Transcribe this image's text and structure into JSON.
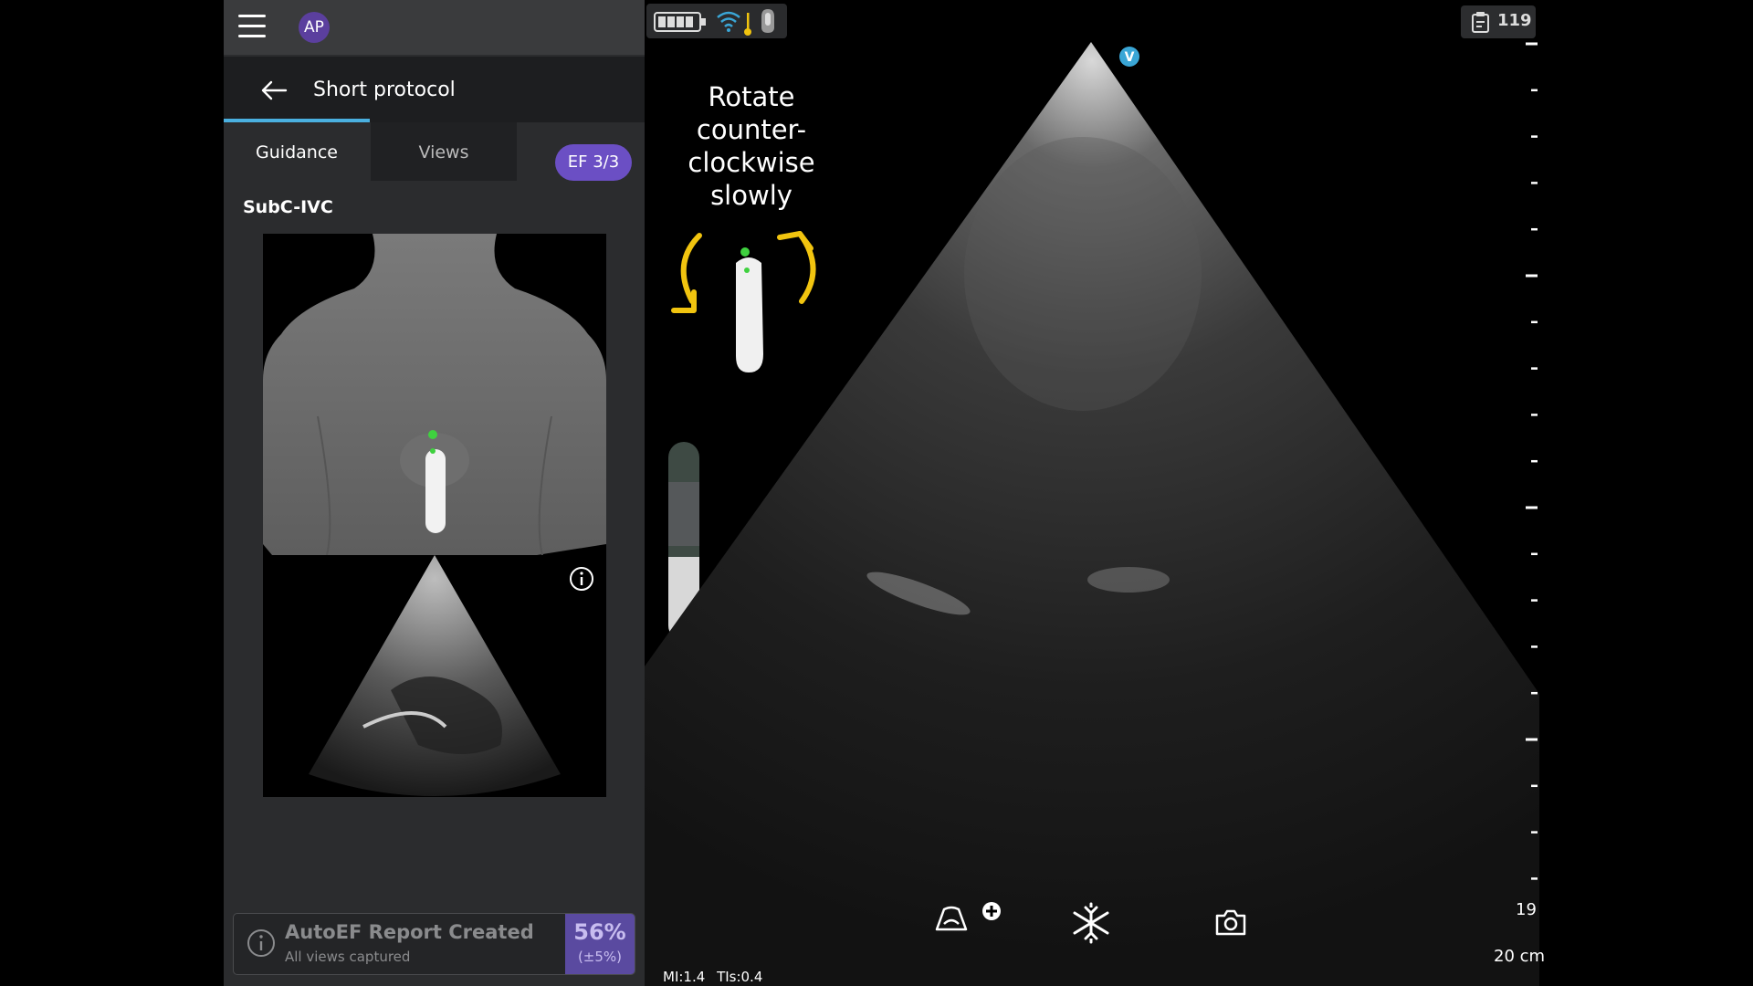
{
  "header": {
    "avatar_initials": "AP",
    "protocol_title": "Short protocol"
  },
  "tabs": [
    {
      "label": "Guidance",
      "active": true
    },
    {
      "label": "Views",
      "active": false
    }
  ],
  "ef_badge": "EF 3/3",
  "view_name": "SubC-IVC",
  "report": {
    "title": "AutoEF Report Created",
    "subtitle": "All views captured",
    "percent": "56%",
    "range": "(±5%)"
  },
  "instruction": {
    "lines": [
      "Rotate",
      "counter-",
      "clockwise",
      "slowly"
    ]
  },
  "quality_level": 0.42,
  "orientation_marker": "V",
  "clip_count": "119",
  "depth": {
    "mark_label": "19",
    "total_label": "20 cm"
  },
  "readout": {
    "mi": "MI:1.4",
    "tis": "TIs:0.4"
  },
  "icons": {
    "menu": "hamburger-icon",
    "back": "back-arrow-icon",
    "info": "info-icon",
    "battery": "battery-icon",
    "wifi": "wifi-icon",
    "probe_temp": "thermometer-icon",
    "probe": "probe-icon",
    "clipboard": "clipboard-icon",
    "preset": "cardiac-preset-icon",
    "freeze": "snowflake-icon",
    "capture": "camera-icon",
    "add": "plus-circle-icon"
  },
  "colors": {
    "accent": "#4ab0e0",
    "badge": "#6b4fc4",
    "arrow": "#f1c40f",
    "marker": "#3aa6d6"
  }
}
